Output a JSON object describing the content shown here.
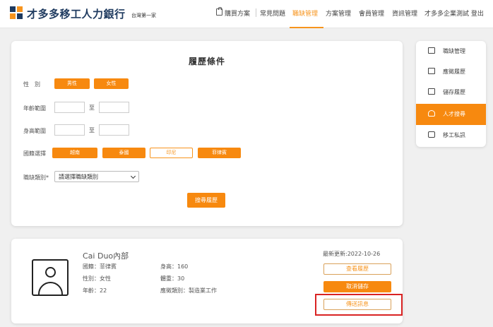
{
  "header": {
    "brand": "才多多移工人力銀行",
    "tagline": "台灣第一家",
    "nav": {
      "purchase": "購買方案",
      "faq": "常見問題",
      "jobs": "職缺管理",
      "plans": "方案管理",
      "members": "會員管理",
      "news": "資訊管理",
      "user": "才多多企業測試 登出"
    }
  },
  "search": {
    "title": "履歷條件",
    "gender_label": "性　別",
    "gender_options": [
      "男性",
      "女性"
    ],
    "age_label": "年齡範圍",
    "height_label": "身高範圍",
    "to_label": "至",
    "nationality_label": "國籍選擇",
    "nationality_options": [
      "越南",
      "泰國",
      "印尼",
      "菲律賓"
    ],
    "job_category_label": "職缺類別*",
    "job_category_placeholder": "請選擇職缺類別",
    "submit_label": "搜尋履歷"
  },
  "sidebar": {
    "items": [
      {
        "label": "職缺管理",
        "icon": "briefcase-icon"
      },
      {
        "label": "應徵履歷",
        "icon": "document-icon"
      },
      {
        "label": "儲存履歷",
        "icon": "folder-icon"
      },
      {
        "label": "人才搜尋",
        "icon": "person-search-icon"
      },
      {
        "label": "移工私訊",
        "icon": "chat-icon"
      }
    ]
  },
  "resume": {
    "name": "Cai Duo內部",
    "nationality": "國籍：菲律賓",
    "gender": "性別：女性",
    "age": "年齡：22",
    "height": "身高：160",
    "weight": "體重：30",
    "category": "應徵類別：製造業工作",
    "updated": "最新更新:2022-10-26",
    "view_label": "查看履歷",
    "unsave_label": "取消儲存",
    "message_label": "傳送訊息"
  },
  "colors": {
    "accent": "#f7890f",
    "brand": "#1e3a5f",
    "highlight": "#d92323"
  }
}
